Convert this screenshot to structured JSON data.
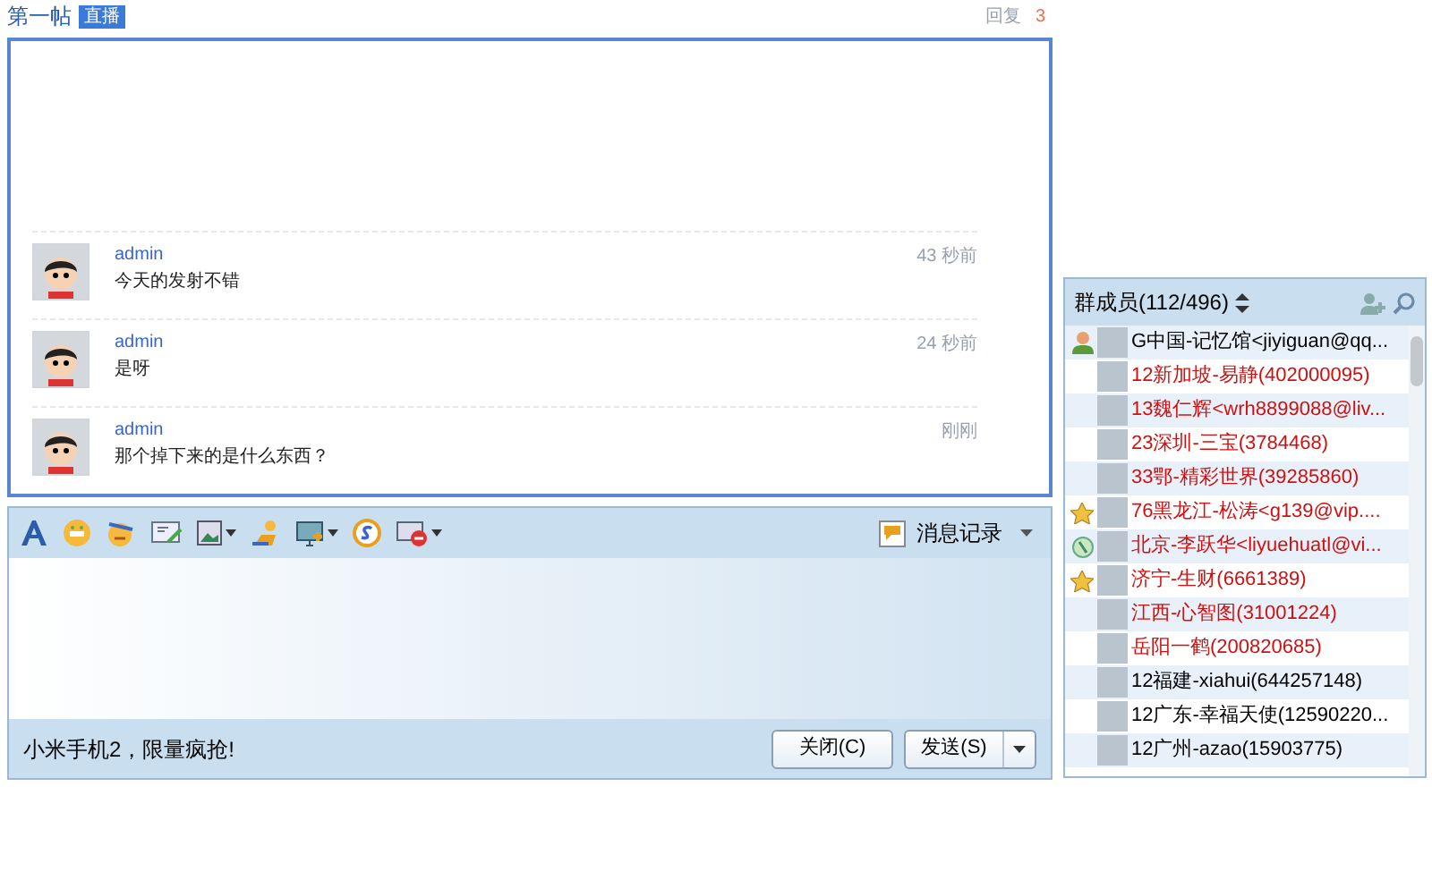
{
  "header": {
    "title": "第一帖",
    "badge": "直播",
    "reply_label": "回复",
    "reply_count": "3"
  },
  "messages": [
    {
      "author": "admin",
      "text": "今天的发射不错",
      "time": "43 秒前"
    },
    {
      "author": "admin",
      "text": "是呀",
      "time": "24 秒前"
    },
    {
      "author": "admin",
      "text": "那个掉下来的是什么东西？",
      "time": "刚刚"
    }
  ],
  "composer": {
    "history_label": "消息记录",
    "ad_text": "小米手机2，限量疯抢!",
    "buttons": [
      {
        "label": "关闭(C)",
        "kind": "plain"
      },
      {
        "label": "发送(S)",
        "kind": "split"
      }
    ]
  },
  "members": {
    "title": "群成员(112/496)",
    "items": [
      {
        "name": "G中国-记忆馆<jiyiguan@qq...",
        "kind": "person",
        "highlighted": false
      },
      {
        "name": "12新加坡-易静(402000095)",
        "kind": "plain",
        "highlighted": true
      },
      {
        "name": "13魏仁辉<wrh8899088@liv...",
        "kind": "plain",
        "highlighted": true
      },
      {
        "name": "23深圳-三宝(3784468)",
        "kind": "plain",
        "highlighted": true
      },
      {
        "name": "33鄂-精彩世界(39285860)",
        "kind": "plain",
        "highlighted": true
      },
      {
        "name": "76黑龙江-松涛<g139@vip....",
        "kind": "star",
        "highlighted": true
      },
      {
        "name": "北京-李跃华<liyuehuatl@vi...",
        "kind": "phone",
        "highlighted": true
      },
      {
        "name": "济宁-生财(6661389)",
        "kind": "star",
        "highlighted": true
      },
      {
        "name": "江西-心智图(31001224)",
        "kind": "plain",
        "highlighted": true
      },
      {
        "name": "岳阳一鹤(200820685)",
        "kind": "plain",
        "highlighted": true
      },
      {
        "name": "12福建-xiahui(644257148)",
        "kind": "plain",
        "highlighted": false
      },
      {
        "name": "12广东-幸福天使(12590220...",
        "kind": "plain",
        "highlighted": false
      },
      {
        "name": "12广州-azao(15903775)",
        "kind": "plain",
        "highlighted": false
      }
    ]
  }
}
